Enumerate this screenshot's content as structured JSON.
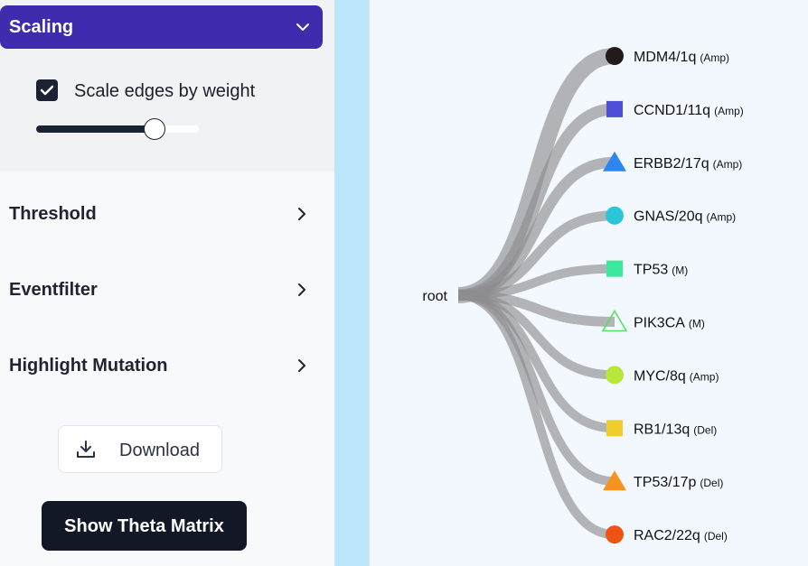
{
  "sidebar": {
    "scaling": {
      "title": "Scaling",
      "checkbox_label": "Scale edges by weight",
      "checked": true,
      "slider_value": 0.72
    },
    "sections": [
      {
        "label": "Threshold"
      },
      {
        "label": "Eventfilter"
      },
      {
        "label": "Highlight Mutation"
      }
    ],
    "download_label": "Download",
    "theta_label": "Show Theta Matrix"
  },
  "tree": {
    "root_label": "root",
    "nodes": [
      {
        "name": "MDM4/1q",
        "type": "(Amp)",
        "shape": "circle",
        "color": "#231a1c",
        "weight": 18
      },
      {
        "name": "CCND1/11q",
        "type": "(Amp)",
        "shape": "square",
        "color": "#4b4fd6",
        "weight": 13
      },
      {
        "name": "ERBB2/17q",
        "type": "(Amp)",
        "shape": "triangle",
        "color": "#2f86f0",
        "weight": 12
      },
      {
        "name": "GNAS/20q",
        "type": "(Amp)",
        "shape": "circle",
        "color": "#2ac6d8",
        "weight": 11
      },
      {
        "name": "TP53",
        "type": "(M)",
        "shape": "square",
        "color": "#3ce99c",
        "weight": 10
      },
      {
        "name": "PIK3CA",
        "type": "(M)",
        "shape": "triangle-outline",
        "color": "#54e35c",
        "weight": 11
      },
      {
        "name": "MYC/8q",
        "type": "(Amp)",
        "shape": "circle",
        "color": "#b6e83c",
        "weight": 10
      },
      {
        "name": "RB1/13q",
        "type": "(Del)",
        "shape": "square",
        "color": "#f1cc2d",
        "weight": 10
      },
      {
        "name": "TP53/17p",
        "type": "(Del)",
        "shape": "triangle",
        "color": "#f7931e",
        "weight": 10
      },
      {
        "name": "RAC2/22q",
        "type": "(Del)",
        "shape": "circle",
        "color": "#ef5314",
        "weight": 10
      }
    ]
  }
}
